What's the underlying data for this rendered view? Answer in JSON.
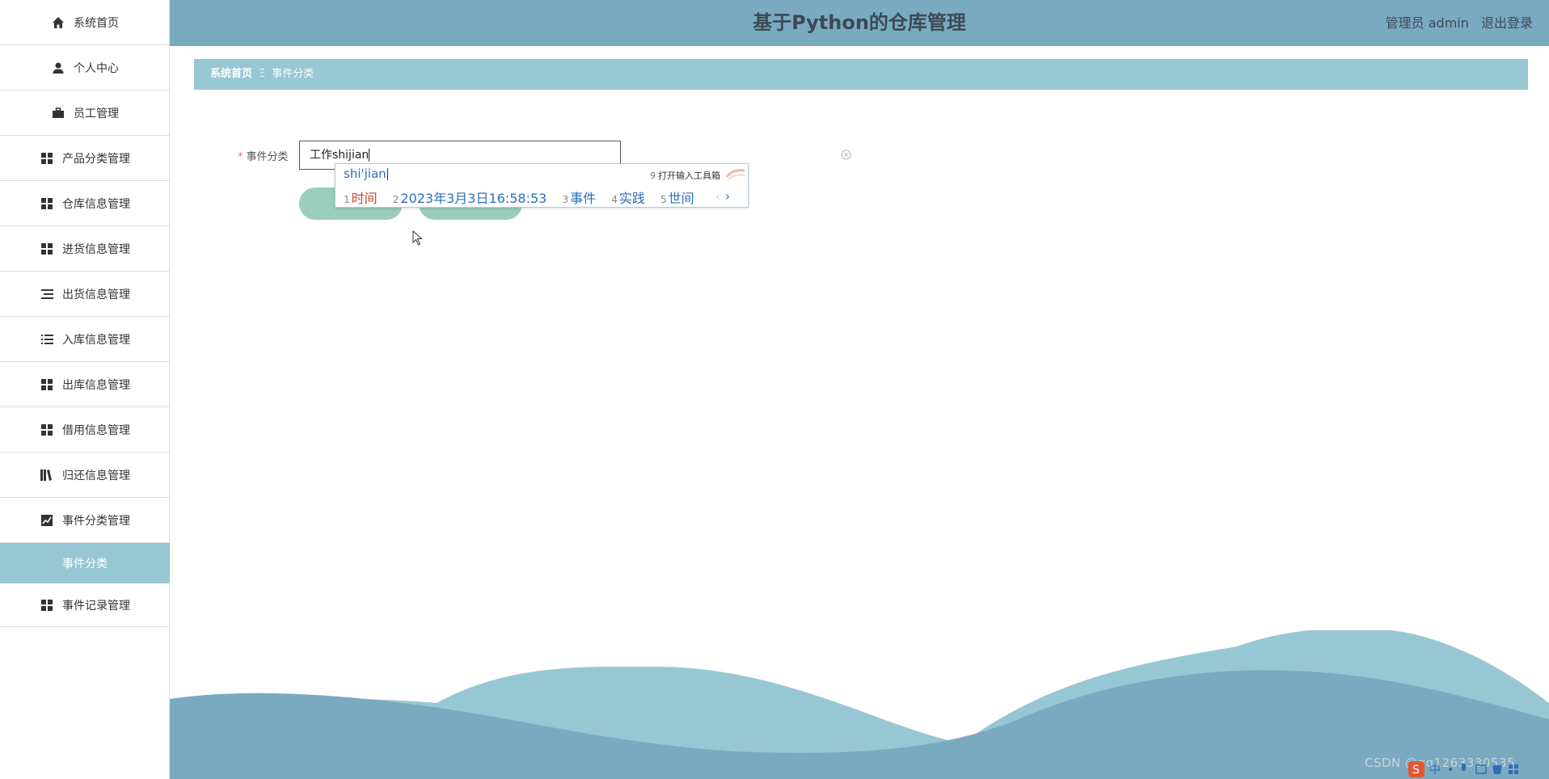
{
  "app": {
    "title": "基于Python的仓库管理",
    "user_label": "管理员 admin",
    "logout_label": "退出登录"
  },
  "sidebar": {
    "items": [
      {
        "label": "系统首页",
        "icon": "home-icon"
      },
      {
        "label": "个人中心",
        "icon": "user-icon"
      },
      {
        "label": "员工管理",
        "icon": "briefcase-icon"
      },
      {
        "label": "产品分类管理",
        "icon": "grid-icon"
      },
      {
        "label": "仓库信息管理",
        "icon": "grid-icon"
      },
      {
        "label": "进货信息管理",
        "icon": "grid-icon"
      },
      {
        "label": "出货信息管理",
        "icon": "list-icon"
      },
      {
        "label": "入库信息管理",
        "icon": "list-icon"
      },
      {
        "label": "出库信息管理",
        "icon": "grid-icon"
      },
      {
        "label": "借用信息管理",
        "icon": "grid-icon"
      },
      {
        "label": "归还信息管理",
        "icon": "books-icon"
      },
      {
        "label": "事件分类管理",
        "icon": "chart-icon"
      },
      {
        "label": "事件分类",
        "icon": "",
        "active": true
      },
      {
        "label": "事件记录管理",
        "icon": "grid-icon"
      }
    ]
  },
  "breadcrumb": {
    "home": "系统首页",
    "separator": "Ξ",
    "current": "事件分类"
  },
  "form": {
    "required_mark": "*",
    "field_label": "事件分类",
    "field_value": "工作shijian"
  },
  "ime": {
    "pinyin": "shi'jian",
    "tool_num": "9",
    "tool_label": "打开输入工具箱",
    "candidates": [
      {
        "n": "1",
        "text": "时间"
      },
      {
        "n": "2",
        "text": "2023年3月3日16:58:53"
      },
      {
        "n": "3",
        "text": "事件"
      },
      {
        "n": "4",
        "text": "实践"
      },
      {
        "n": "5",
        "text": "世间"
      }
    ],
    "prev": "‹",
    "next": "›"
  },
  "footer": {
    "watermark": "CSDN @qq1263330535"
  },
  "colors": {
    "header": "#7aaac0",
    "accent": "#98c7d4",
    "wave_light": "#98c7d4",
    "wave_dark": "#7aaac0",
    "button": "#9bcdbb"
  }
}
